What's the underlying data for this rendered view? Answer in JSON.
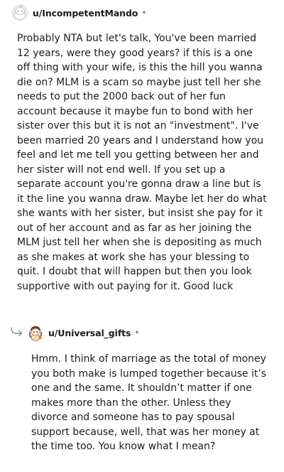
{
  "comments": [
    {
      "username": "u/IncompetentMando",
      "separator": "•",
      "avatar_icon": "snoo-default-avatar-icon",
      "text": "Probably NTA but let's talk, You've been married 12 years, were they good years? if this is a one off thing with your wife, is this the hill you wanna die on? MLM is a scam so maybe just tell her she needs to put the 2000 back out of her fun account because it maybe fun to bond with her sister over this but it is not an \"investment\". I've been married 20 years and I understand how you feel and let me tell you getting between her and her sister will not end well. If you set up a separate account you're gonna draw a line but is it the line you wanna draw. Maybe let her do what she wants with her sister, but insist she pay for it out of her account and as far as her joining the MLM just tell her when she is depositing as much as she makes at work she has your blessing to quit. I doubt that will happen but then you look supportive with out paying for it. Good luck"
    },
    {
      "username": "u/Universal_gifts",
      "separator": "•",
      "avatar_icon": "custom-snoo-avatar-icon",
      "reply_icon": "reply-arrow-icon",
      "text": "Hmm. I think of marriage as the total of money you both make is lumped together because it’s one and the same. It shouldn’t matter if one makes more than the other. Unless they divorce and someone has to pay spousal support because, well, that was her money at the time too. You know what I mean?"
    }
  ]
}
